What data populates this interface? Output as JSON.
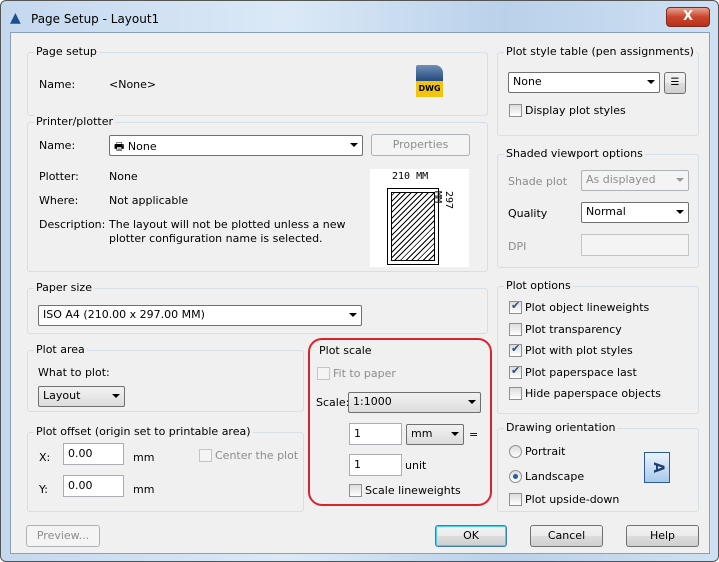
{
  "window": {
    "title": "Page Setup - Layout1",
    "close": "X"
  },
  "page_setup": {
    "label": "Page setup",
    "name_label": "Name:",
    "name_value": "<None>",
    "icon_text": "DWG"
  },
  "printer": {
    "label": "Printer/plotter",
    "name_label": "Name:",
    "name_value": "None",
    "properties": "Properties",
    "plotter_label": "Plotter:",
    "plotter_value": "None",
    "where_label": "Where:",
    "where_value": "Not applicable",
    "desc_label": "Description:",
    "desc_value": "The layout will not be plotted unless a new plotter configuration name is selected.",
    "preview_width": "210 MM",
    "preview_height": "297 MM"
  },
  "paper_size": {
    "label": "Paper size",
    "value": "ISO A4 (210.00 x 297.00 MM)"
  },
  "plot_area": {
    "label": "Plot area",
    "what_label": "What to plot:",
    "value": "Layout"
  },
  "plot_offset": {
    "label": "Plot offset (origin set to printable area)",
    "x_label": "X:",
    "x_value": "0.00",
    "y_label": "Y:",
    "y_value": "0.00",
    "unit": "mm",
    "center": "Center the plot"
  },
  "plot_scale": {
    "label": "Plot scale",
    "fit": "Fit to paper",
    "scale_label": "Scale:",
    "scale_value": "1:1000",
    "num": "1",
    "num_unit": "mm",
    "equals": "=",
    "den": "1",
    "den_unit": "unit",
    "lineweights": "Scale lineweights",
    "highlight": "#d9232e"
  },
  "plot_style": {
    "label": "Plot style table (pen assignments)",
    "value": "None",
    "display": "Display plot styles"
  },
  "shaded": {
    "label": "Shaded viewport options",
    "shade_label": "Shade plot",
    "shade_value": "As displayed",
    "quality_label": "Quality",
    "quality_value": "Normal",
    "dpi_label": "DPI"
  },
  "plot_options": {
    "label": "Plot options",
    "items": [
      {
        "label": "Plot object lineweights",
        "checked": true
      },
      {
        "label": "Plot transparency",
        "checked": false
      },
      {
        "label": "Plot with plot styles",
        "checked": true
      },
      {
        "label": "Plot paperspace last",
        "checked": true
      },
      {
        "label": "Hide paperspace objects",
        "checked": false
      }
    ]
  },
  "orientation": {
    "label": "Drawing orientation",
    "portrait": "Portrait",
    "landscape": "Landscape",
    "selected": "Landscape",
    "upside": "Plot upside-down",
    "icon_text": "A"
  },
  "buttons": {
    "preview": "Preview...",
    "ok": "OK",
    "cancel": "Cancel",
    "help": "Help"
  }
}
